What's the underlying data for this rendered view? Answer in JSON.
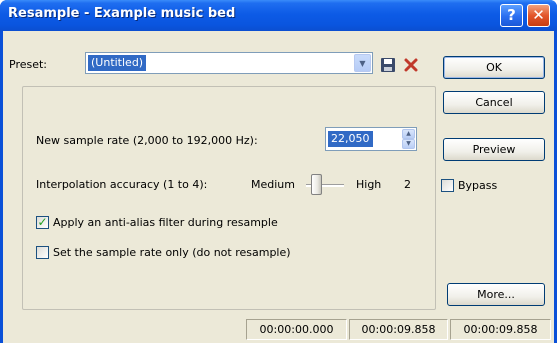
{
  "window": {
    "title": "Resample - Example music bed"
  },
  "titlebar_buttons": {
    "help": "?",
    "close": "✕"
  },
  "preset": {
    "label": "Preset:",
    "value": "(Untitled)"
  },
  "buttons": {
    "ok": "OK",
    "cancel": "Cancel",
    "preview": "Preview",
    "more": "More..."
  },
  "bypass": {
    "label": "Bypass",
    "checked": false
  },
  "sample_rate": {
    "label": "New sample rate (2,000 to 192,000 Hz):",
    "value": "22,050"
  },
  "interpolation": {
    "label": "Interpolation accuracy (1 to 4):",
    "low_label": "Medium",
    "high_label": "High",
    "value": "2"
  },
  "options": {
    "anti_alias": {
      "label": "Apply an anti-alias filter during resample",
      "checked": true
    },
    "rate_only": {
      "label": "Set the sample rate only (do not resample)",
      "checked": false
    }
  },
  "status": {
    "start": "00:00:00.000",
    "end": "00:00:09.858",
    "length": "00:00:09.858"
  },
  "icons": {
    "save": "save-icon",
    "delete": "delete-icon",
    "dropdown": "chevron-down-icon"
  },
  "colors": {
    "title_bar": "#0a55df",
    "selection": "#316ac5",
    "dialog_bg": "#ece9d8",
    "delete_icon": "#c0392b"
  }
}
